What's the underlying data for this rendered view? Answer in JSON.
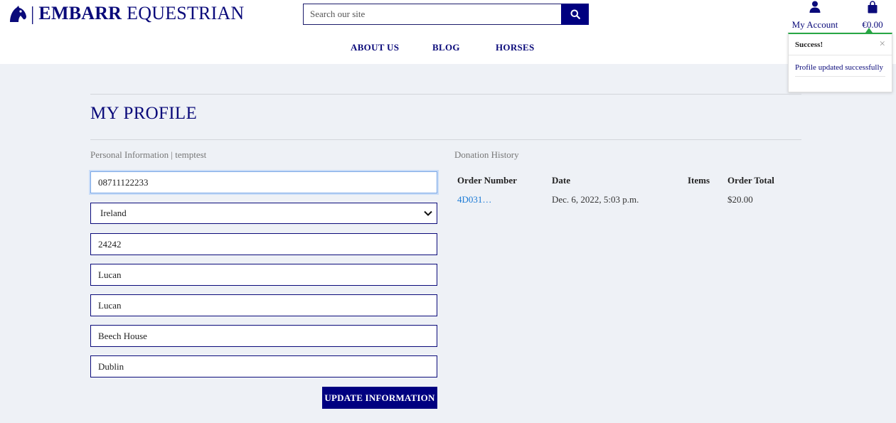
{
  "header": {
    "brand_bold": "EMBARR",
    "brand_rest": "EQUESTRIAN",
    "brand_separator": "|",
    "search_placeholder": "Search our site",
    "account_label": "My Account",
    "cart_total": "€0.00"
  },
  "nav": {
    "items": [
      "ABOUT US",
      "BLOG",
      "HORSES"
    ]
  },
  "toast": {
    "title": "Success!",
    "message": "Profile updated successfully",
    "accent_color": "#28a745"
  },
  "page": {
    "title": "MY PROFILE"
  },
  "profile": {
    "section_label": "Personal Information | temptest",
    "phone": "08711122233",
    "country": "Ireland",
    "postcode": "24242",
    "town_city": "Lucan",
    "street_address1": "Lucan",
    "street_address2": "Beech House",
    "county": "Dublin",
    "update_label": "UPDATE INFORMATION"
  },
  "donations": {
    "section_label": "Donation History",
    "columns": [
      "Order Number",
      "Date",
      "Items",
      "Order Total"
    ],
    "rows": [
      {
        "order_number": "4D031…",
        "date": "Dec. 6, 2022, 5:03 p.m.",
        "items": "",
        "total": "$20.00"
      }
    ]
  },
  "colors": {
    "brand_navy": "#000080",
    "background": "#eef1f6",
    "link": "#1a7ad6"
  }
}
